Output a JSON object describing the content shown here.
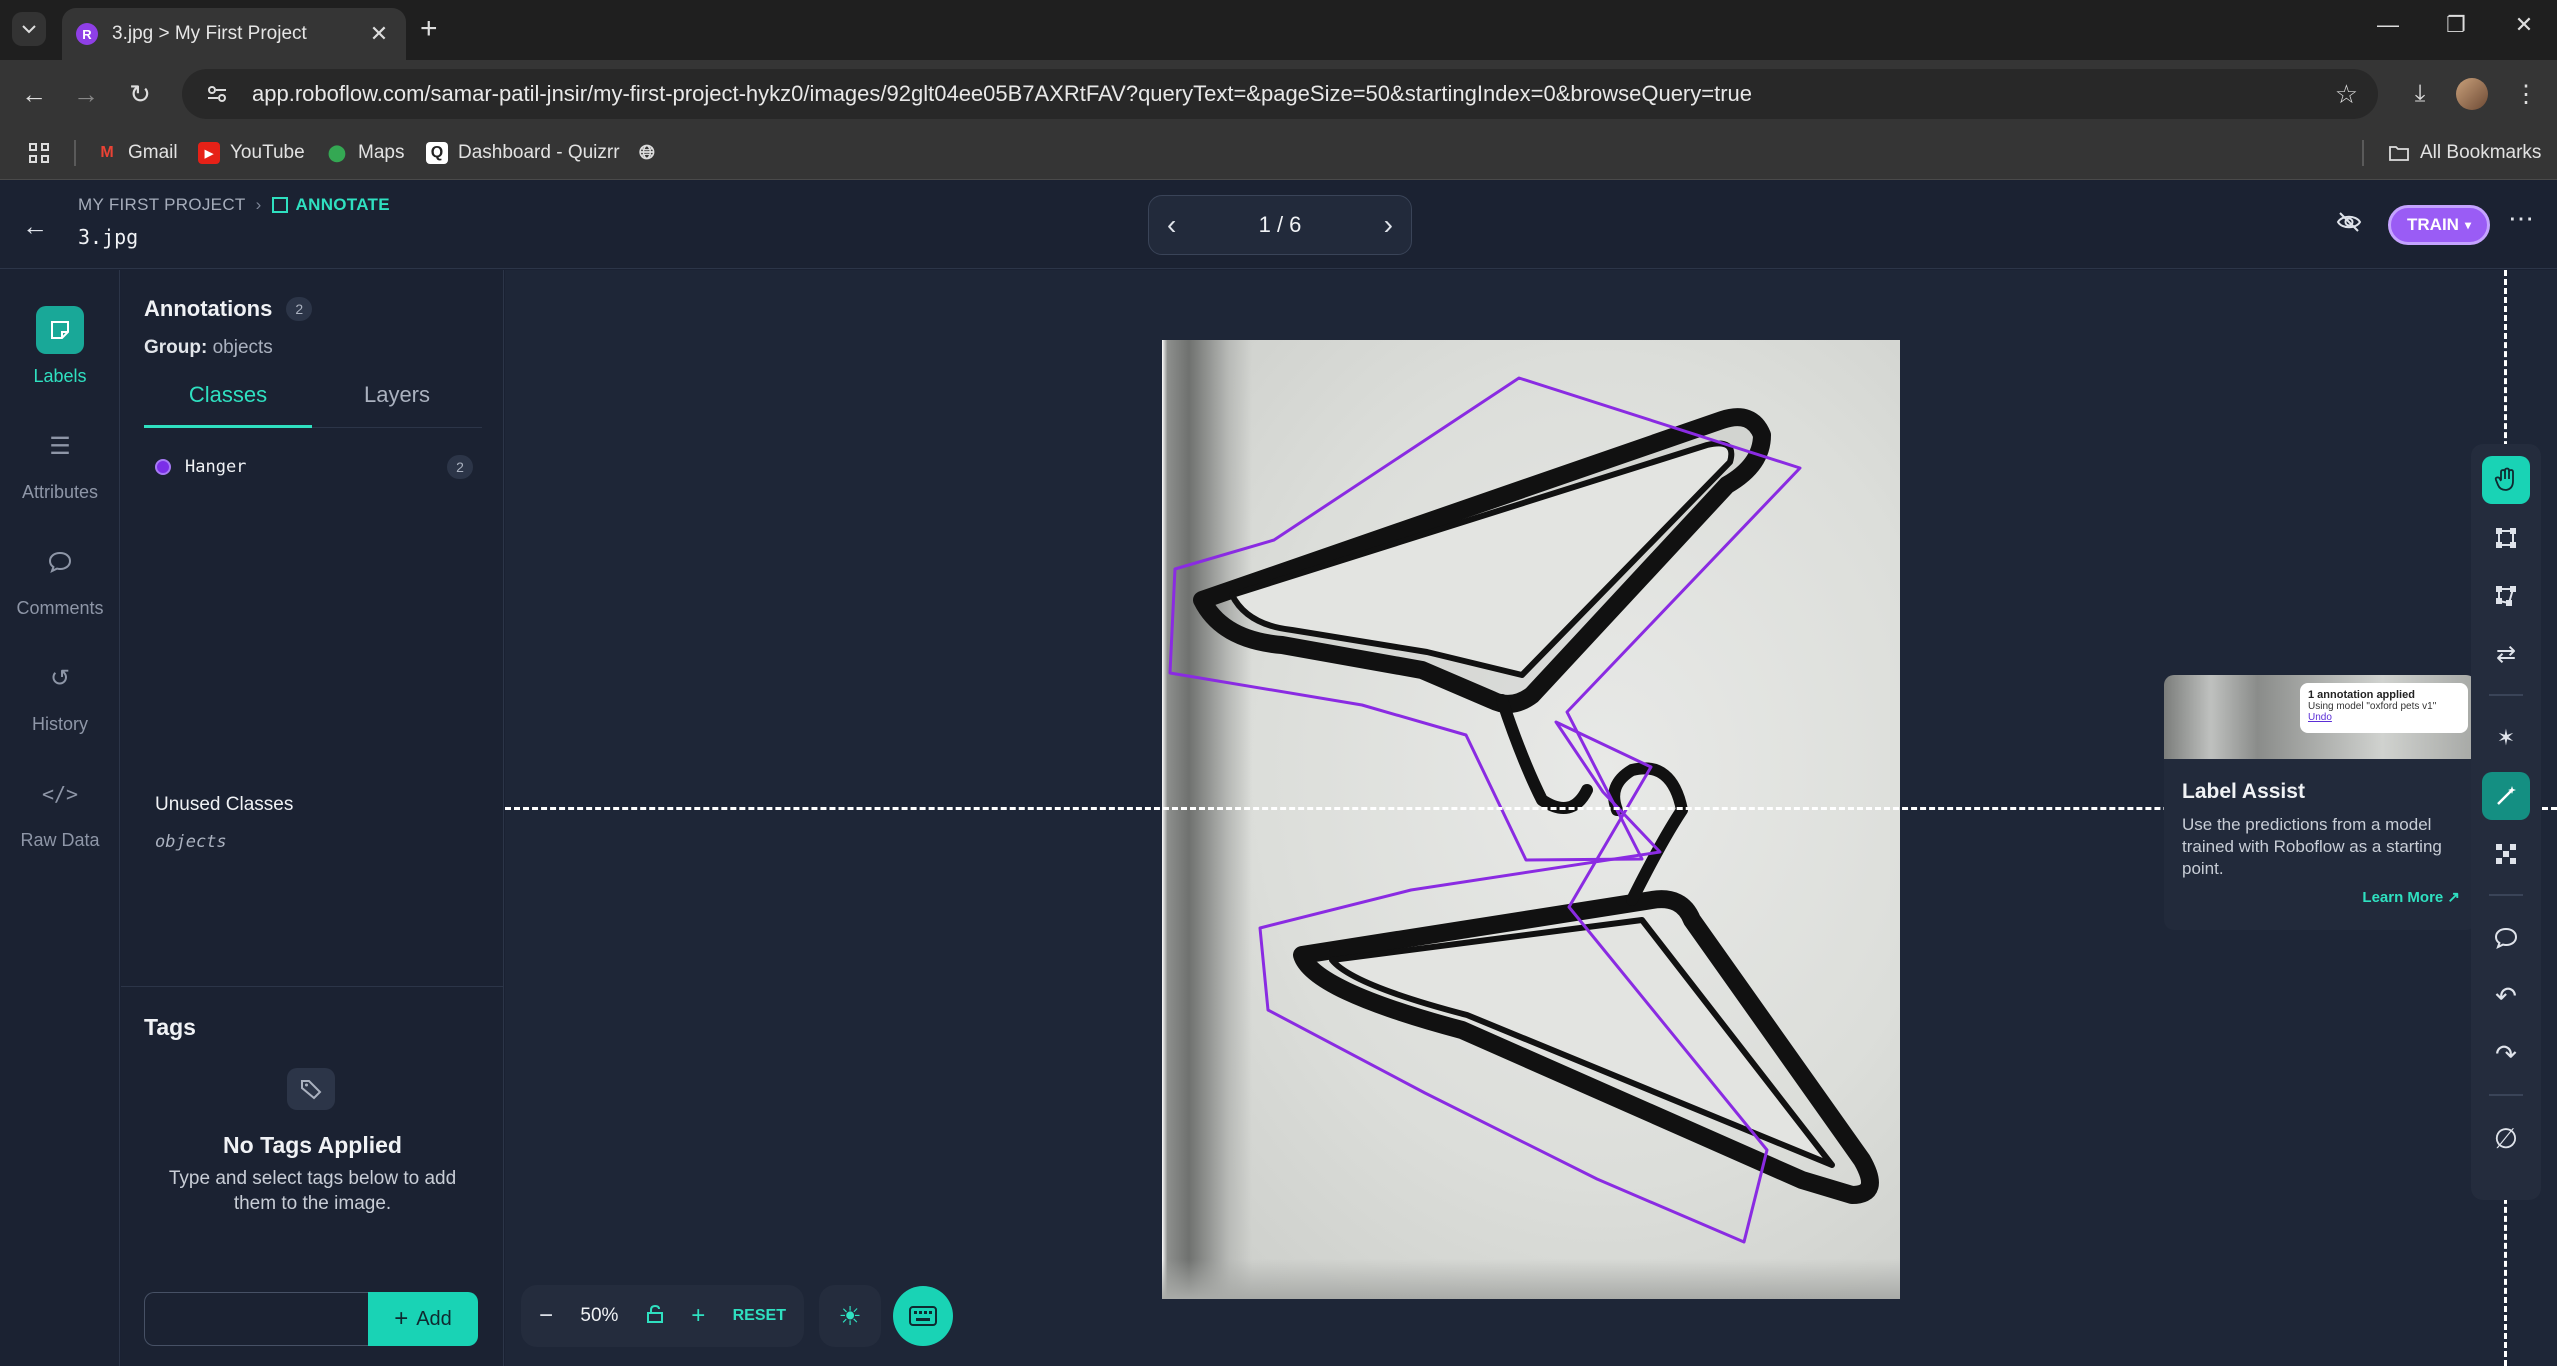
{
  "browser": {
    "tab_title": "3.jpg > My First Project",
    "url": "app.roboflow.com/samar-patil-jnsir/my-first-project-hykz0/images/92glt04ee05B7AXRtFAV?queryText=&pageSize=50&startingIndex=0&browseQuery=true",
    "bookmarks": [
      "Gmail",
      "YouTube",
      "Maps",
      "Dashboard - Quizrr"
    ],
    "all_bookmarks": "All Bookmarks"
  },
  "header": {
    "project": "MY FIRST PROJECT",
    "section": "ANNOTATE",
    "file_name": "3.jpg",
    "pager": "1 / 6",
    "train_label": "TRAIN"
  },
  "rail": {
    "items": [
      {
        "label": "Labels",
        "icon": "labels-icon"
      },
      {
        "label": "Attributes",
        "icon": "list-icon"
      },
      {
        "label": "Comments",
        "icon": "comment-icon"
      },
      {
        "label": "History",
        "icon": "history-icon"
      },
      {
        "label": "Raw Data",
        "icon": "code-icon"
      }
    ]
  },
  "panel": {
    "title": "Annotations",
    "count": "2",
    "group_label": "Group:",
    "group_value": "objects",
    "tabs": [
      "Classes",
      "Layers"
    ],
    "classes": [
      {
        "name": "Hanger",
        "count": "2",
        "color": "#7b2fe8"
      }
    ],
    "unused_title": "Unused Classes",
    "unused": [
      "objects"
    ],
    "tags_title": "Tags",
    "no_tags_title": "No Tags Applied",
    "no_tags_desc": "Type and select tags below to add them to the image.",
    "add_label": "Add"
  },
  "canvas": {
    "zoom": "50%",
    "reset_label": "RESET",
    "polygon_color": "#8a2be2"
  },
  "label_assist": {
    "title": "Label Assist",
    "desc": "Use the predictions from a model trained with Roboflow as a starting point.",
    "learn_more": "Learn More ↗",
    "toast_title": "1 annotation applied",
    "toast_sub": "Using model \"oxford pets v1\"",
    "toast_undo": "Undo"
  }
}
